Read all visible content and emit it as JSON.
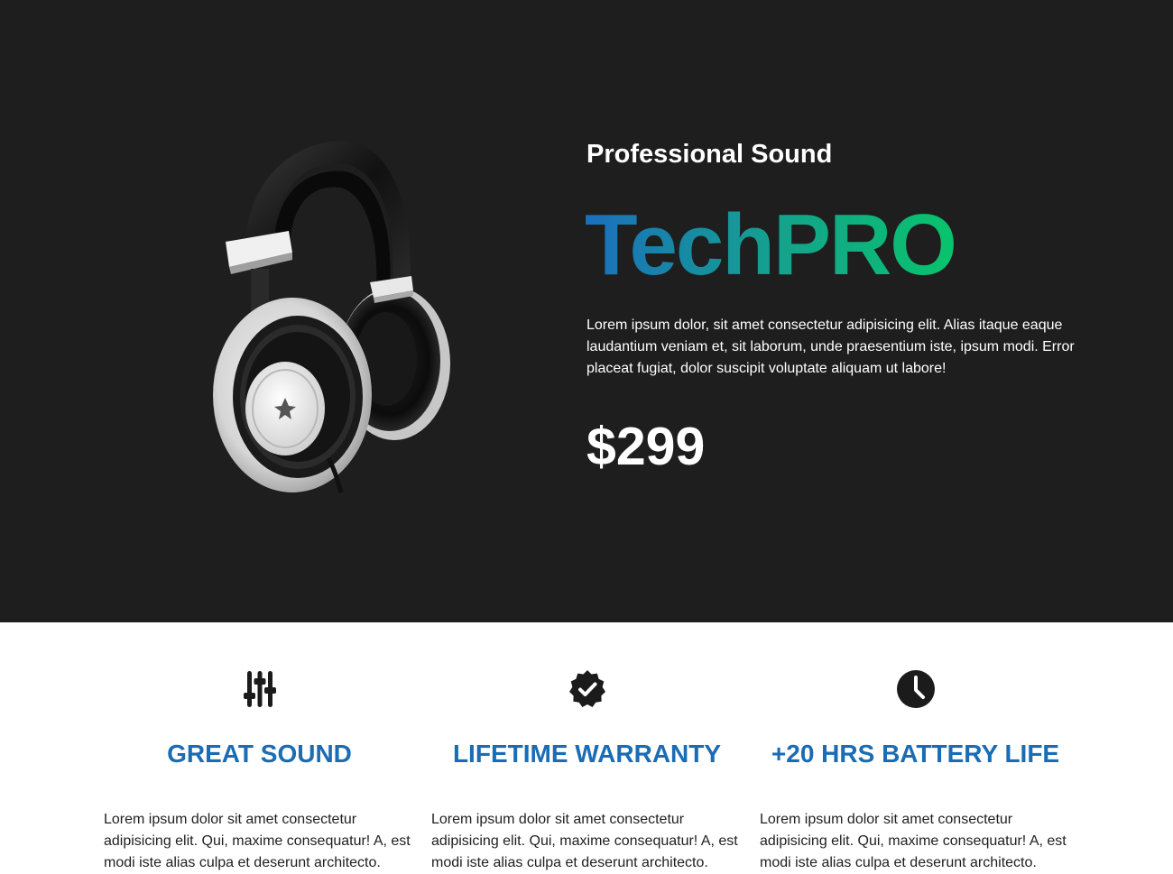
{
  "hero": {
    "subtitle": "Professional Sound",
    "brand": "TechPRO",
    "description": "Lorem ipsum dolor, sit amet consectetur adipisicing elit. Alias itaque eaque laudantium veniam et, sit laborum, unde praesentium iste, ipsum modi. Error placeat fugiat, dolor suscipit voluptate aliquam ut labore!",
    "price": "$299",
    "image_icon": "headphones-image",
    "colors": {
      "background": "#1e1e1f",
      "brand_gradient_start": "#1b6fbd",
      "brand_gradient_end": "#08c46c"
    }
  },
  "features": [
    {
      "icon": "sliders-icon",
      "title": "GREAT SOUND",
      "text": "Lorem ipsum dolor sit amet consectetur adipisicing elit. Qui, maxime consequatur! A, est modi iste alias culpa et deserunt architecto."
    },
    {
      "icon": "badge-check-icon",
      "title": "LIFETIME WARRANTY",
      "text": "Lorem ipsum dolor sit amet consectetur adipisicing elit. Qui, maxime consequatur! A, est modi iste alias culpa et deserunt architecto."
    },
    {
      "icon": "clock-icon",
      "title": "+20 HRS BATTERY LIFE",
      "text": "Lorem ipsum dolor sit amet consectetur adipisicing elit. Qui, maxime consequatur! A, est modi iste alias culpa et deserunt architecto."
    }
  ],
  "colors": {
    "feature_heading": "#1a6cb4",
    "feature_text": "#1f1f1f"
  }
}
